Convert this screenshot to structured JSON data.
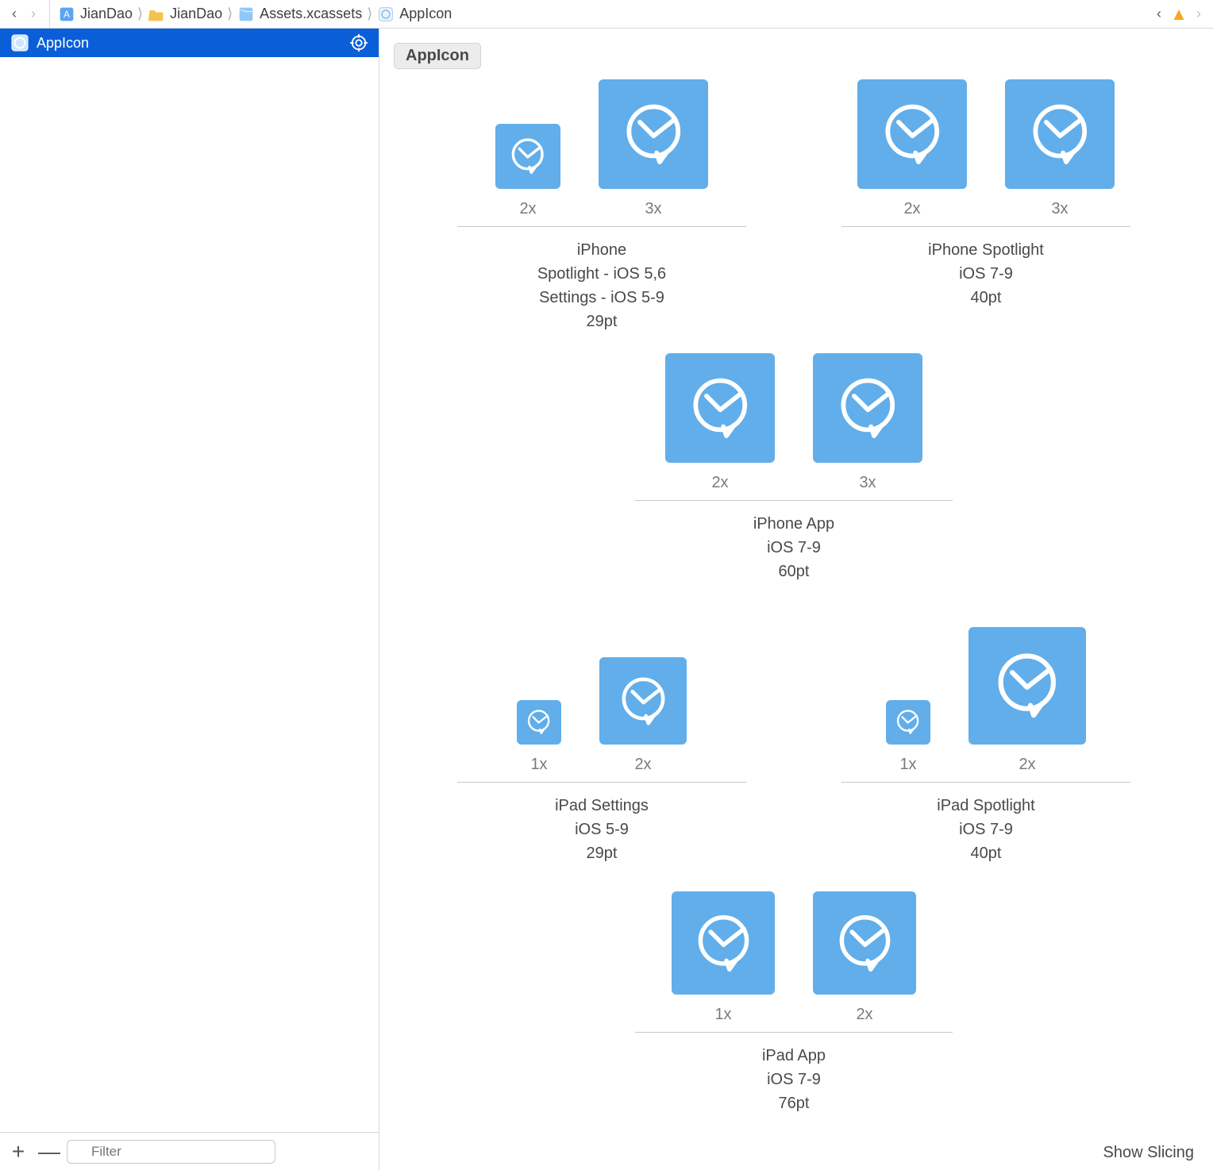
{
  "breadcrumb": {
    "back": "‹",
    "forward": "›",
    "items": [
      {
        "label": "JianDao",
        "icon": "proj"
      },
      {
        "label": "JianDao",
        "icon": "folder"
      },
      {
        "label": "Assets.xcassets",
        "icon": "assets"
      },
      {
        "label": "AppIcon",
        "icon": "appicon"
      }
    ],
    "right_back": "‹",
    "right_forward": "›"
  },
  "sidebar": {
    "items": [
      {
        "label": "AppIcon"
      }
    ],
    "footer": {
      "add": "+",
      "remove": "—",
      "filter_placeholder": "Filter"
    }
  },
  "editor": {
    "set_title": "AppIcon",
    "show_slicing": "Show Slicing",
    "rows": [
      [
        {
          "slots": [
            {
              "scale": "2x",
              "size": 82
            },
            {
              "scale": "3x",
              "size": 138
            }
          ],
          "desc": [
            "iPhone",
            "Spotlight - iOS 5,6",
            "Settings - iOS 5-9",
            "29pt"
          ]
        },
        {
          "slots": [
            {
              "scale": "2x",
              "size": 138
            },
            {
              "scale": "3x",
              "size": 138
            }
          ],
          "desc": [
            "iPhone Spotlight",
            "iOS 7-9",
            "40pt"
          ]
        }
      ],
      [
        {
          "center": true,
          "slots": [
            {
              "scale": "2x",
              "size": 138
            },
            {
              "scale": "3x",
              "size": 138
            }
          ],
          "desc": [
            "iPhone App",
            "iOS 7-9",
            "60pt"
          ]
        }
      ],
      [
        {
          "tall": true,
          "slots": [
            {
              "scale": "1x",
              "size": 56
            },
            {
              "scale": "2x",
              "size": 110
            }
          ],
          "desc": [
            "iPad Settings",
            "iOS 5-9",
            "29pt"
          ]
        },
        {
          "tall": true,
          "slots": [
            {
              "scale": "1x",
              "size": 56
            },
            {
              "scale": "2x",
              "size": 148
            }
          ],
          "desc": [
            "iPad Spotlight",
            "iOS 7-9",
            "40pt"
          ]
        }
      ],
      [
        {
          "center": true,
          "slots": [
            {
              "scale": "1x",
              "size": 130
            },
            {
              "scale": "2x",
              "size": 130
            }
          ],
          "desc": [
            "iPad App",
            "iOS 7-9",
            "76pt"
          ]
        }
      ]
    ]
  }
}
